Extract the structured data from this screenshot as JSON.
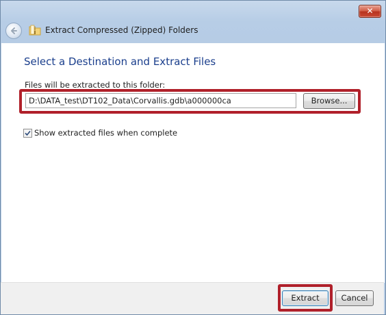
{
  "window": {
    "title": "Extract Compressed (Zipped) Folders",
    "close_label": "✕"
  },
  "main": {
    "heading": "Select a Destination and Extract Files",
    "folder_label": "Files will be extracted to this folder:",
    "destination_path": "D:\\DATA_test\\DT102_Data\\Corvallis.gdb\\a000000ca",
    "browse_label": "Browse...",
    "show_files_label": "Show extracted files when complete",
    "show_files_checked": true
  },
  "footer": {
    "extract_label": "Extract",
    "cancel_label": "Cancel"
  },
  "colors": {
    "heading": "#1a3e8c",
    "highlight": "#b0202a",
    "chrome": "#b9cfe7"
  },
  "icons": {
    "back": "back-arrow-icon",
    "folder": "zip-folder-icon",
    "close": "close-icon",
    "check": "checkmark-icon"
  }
}
